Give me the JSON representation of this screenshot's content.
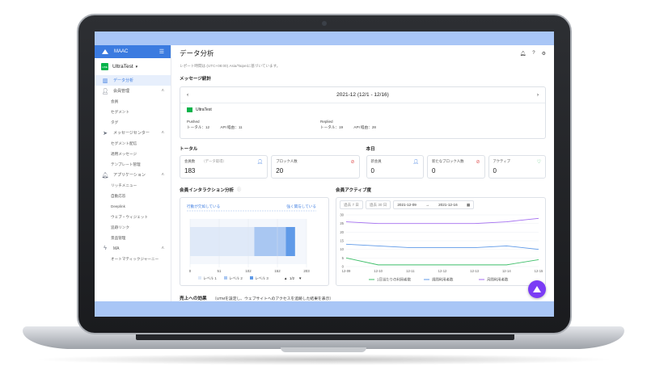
{
  "sidebar": {
    "brand": "MAAC",
    "account": "UltraTest",
    "line_badge": "LINE",
    "items": [
      {
        "label": "データ分析",
        "icon": "chart-icon",
        "active": true
      },
      {
        "label": "会員管理",
        "icon": "user-icon",
        "group": true
      },
      {
        "label": "会員",
        "sub": true
      },
      {
        "label": "セグメント",
        "sub": true
      },
      {
        "label": "タグ",
        "sub": true
      },
      {
        "label": "メッセージセンター",
        "icon": "send-icon",
        "group": true
      },
      {
        "label": "セグメント配信",
        "sub": true
      },
      {
        "label": "適用メッセージ",
        "sub": true
      },
      {
        "label": "テンプレート管理",
        "sub": true
      },
      {
        "label": "アプリケーション",
        "icon": "bell-icon",
        "group": true
      },
      {
        "label": "リッチメニュー",
        "sub": true
      },
      {
        "label": "自動応答",
        "sub": true
      },
      {
        "label": "Deeplink",
        "sub": true
      },
      {
        "label": "ウェブ・ウィジェット",
        "sub": true
      },
      {
        "label": "追跡リンク",
        "sub": true
      },
      {
        "label": "景品管理",
        "sub": true
      },
      {
        "label": "MA",
        "icon": "bolt-icon",
        "group": true
      },
      {
        "label": "オートマティックジャーニー",
        "sub": true
      }
    ]
  },
  "header": {
    "title": "データ分析",
    "report_time": "レポート時間は (UTC+08:00) Asia/Taipeiに基づいています。"
  },
  "message_stats": {
    "section": "メッセージ統計",
    "period": "2021-12 (12/1 - 12/16)",
    "channel": "UltraTest",
    "pushed_label": "Pushed",
    "pushed_total": "トータル：12",
    "pushed_api": "API 経由：11",
    "replied_label": "Replied",
    "replied_total": "トータル：19",
    "replied_api": "API 経由：28"
  },
  "total": {
    "section": "トータル",
    "cards": [
      {
        "label": "会員数",
        "sublabel": "（データ取得）",
        "value": "183",
        "icon": "user-icon"
      },
      {
        "label": "ブロック人数",
        "value": "20",
        "icon": "block-icon"
      }
    ]
  },
  "today": {
    "section": "本日",
    "cards": [
      {
        "label": "新会員",
        "value": "0",
        "icon": "user-icon"
      },
      {
        "label": "新たなブロック人数",
        "value": "0",
        "icon": "block-icon"
      },
      {
        "label": "アクティブ",
        "value": "0",
        "icon": "heart-icon"
      }
    ]
  },
  "interaction": {
    "section": "会員インタラクション分析",
    "left_label": "行動が欠如している",
    "right_label": "強く関与している",
    "ticks": [
      "0",
      "51",
      "102",
      "152",
      "203"
    ],
    "legend": [
      "レベル 1",
      "レベル 2",
      "レベル 3"
    ],
    "pager": "1/2"
  },
  "activity": {
    "section": "会員アクティブ度",
    "range_7": "過去 7 日",
    "range_30": "過去 30 日",
    "date_from": "2021-12-09",
    "date_to": "2021-12-16",
    "legend": [
      "1日当たりの利用者数",
      "週間利用者数",
      "月間利用者数"
    ]
  },
  "sales": {
    "section": "売上への効果",
    "note": "（UTMを設定し、ウェブサイトへのアクセスを追跡した結果を表示）"
  },
  "chart_data": [
    {
      "type": "bar",
      "orientation": "horizontal",
      "stacked": true,
      "categories": [
        "会員"
      ],
      "series": [
        {
          "name": "レベル 1",
          "values": [
            112
          ]
        },
        {
          "name": "レベル 2",
          "values": [
            55
          ]
        },
        {
          "name": "レベル 3",
          "values": [
            16
          ]
        }
      ],
      "xlim": [
        0,
        203
      ],
      "colors": [
        "#dfe9f8",
        "#a9c7f2",
        "#5f9ae8"
      ]
    },
    {
      "type": "line",
      "x": [
        "12-09",
        "12-10",
        "12-11",
        "12-12",
        "12-13",
        "12-14",
        "12-15"
      ],
      "series": [
        {
          "name": "1日当たりの利用者数",
          "values": [
            5,
            1,
            1,
            1,
            1,
            1,
            4
          ]
        },
        {
          "name": "週間利用者数",
          "values": [
            13,
            12,
            11,
            11,
            11,
            12,
            10
          ]
        },
        {
          "name": "月間利用者数",
          "values": [
            26,
            25,
            25,
            25,
            25,
            26,
            28
          ]
        }
      ],
      "ylim": [
        0,
        30
      ],
      "yticks": [
        0,
        5,
        10,
        15,
        20,
        25,
        30
      ],
      "colors": [
        "#3fbf6a",
        "#5f9ae8",
        "#a46ef0"
      ]
    }
  ]
}
